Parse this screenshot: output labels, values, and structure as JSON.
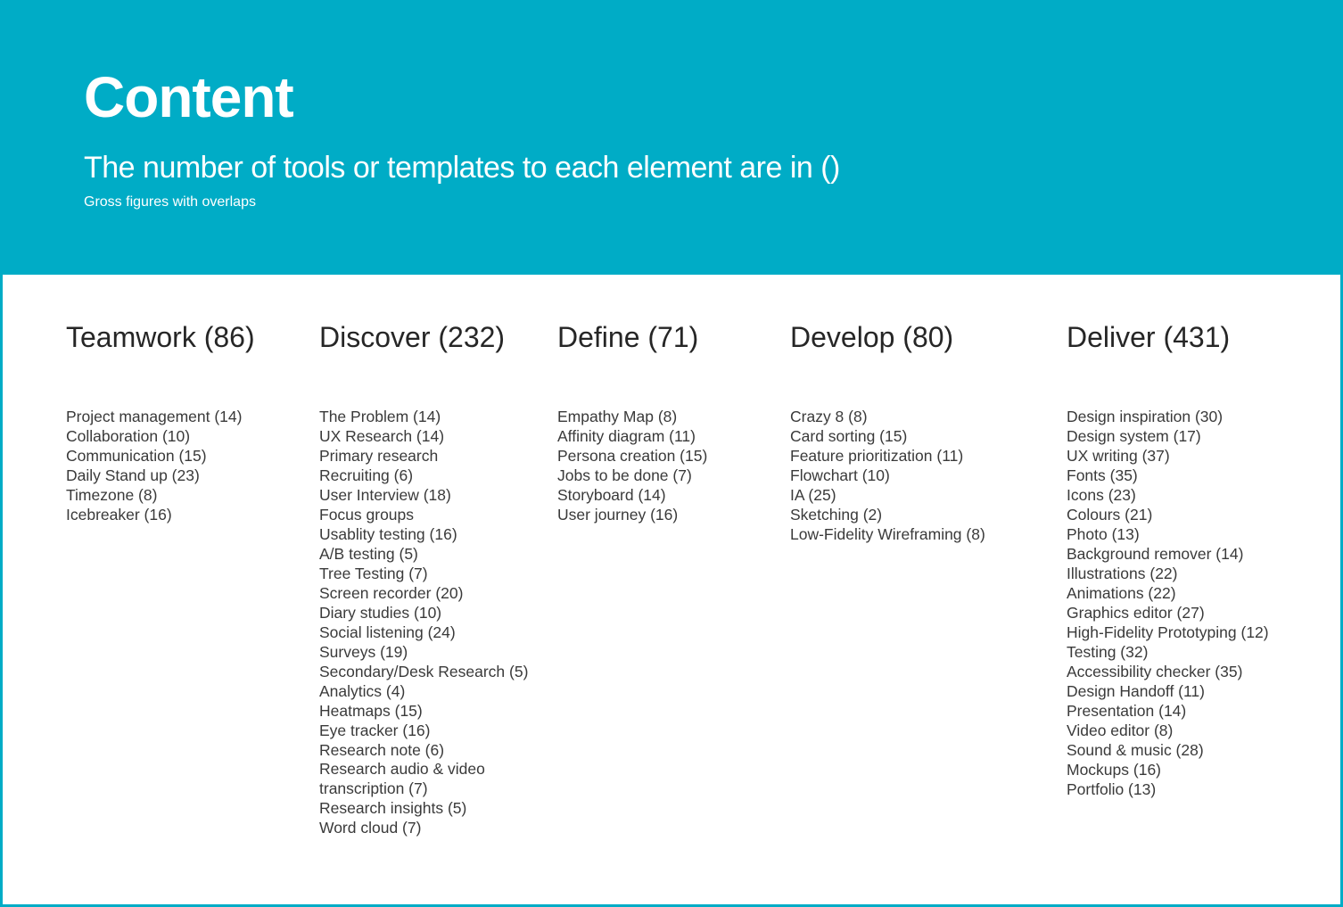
{
  "header": {
    "title": "Content",
    "subtitle": "The number of tools or templates to each element are in ()",
    "note": "Gross figures with overlaps",
    "background_color": "#00ACC6"
  },
  "columns": [
    {
      "heading": "Teamwork (86)",
      "items": [
        "Project management (14)",
        "Collaboration (10)",
        "Communication (15)",
        "Daily Stand up (23)",
        "Timezone (8)",
        "Icebreaker (16)"
      ]
    },
    {
      "heading": "Discover (232)",
      "items": [
        "The Problem (14)",
        "UX Research (14)",
        "Primary research",
        "Recruiting (6)",
        "User Interview (18)",
        "Focus groups",
        "Usablity testing (16)",
        "A/B testing (5)",
        "Tree Testing (7)",
        "Screen recorder (20)",
        "Diary studies (10)",
        "Social listening (24)",
        "Surveys (19)",
        "Secondary/Desk Research (5)",
        "Analytics (4)",
        "Heatmaps (15)",
        "Eye tracker (16)",
        "Research note (6)",
        "Research audio & video transcription (7)",
        "Research insights (5)",
        "Word cloud (7)"
      ]
    },
    {
      "heading": "Define (71)",
      "items": [
        "Empathy Map (8)",
        "Affinity diagram (11)",
        "Persona creation (15)",
        "Jobs to be done (7)",
        "Storyboard (14)",
        "User journey (16)"
      ]
    },
    {
      "heading": "Develop (80)",
      "items": [
        "Crazy 8 (8)",
        "Card sorting (15)",
        "Feature prioritization (11)",
        "Flowchart (10)",
        "IA (25)",
        "Sketching (2)",
        "Low-Fidelity Wireframing (8)"
      ]
    },
    {
      "heading": "Deliver (431)",
      "items": [
        "Design inspiration (30)",
        "Design system (17)",
        "UX writing (37)",
        "Fonts (35)",
        "Icons (23)",
        "Colours (21)",
        "Photo (13)",
        "Background remover (14)",
        "Illustrations (22)",
        "Animations (22)",
        "Graphics editor (27)",
        "High-Fidelity Prototyping (12)",
        "Testing (32)",
        "Accessibility checker (35)",
        "Design Handoff (11)",
        "Presentation (14)",
        "Video editor (8)",
        "Sound & music (28)",
        "Mockups (16)",
        "Portfolio (13)"
      ]
    }
  ]
}
